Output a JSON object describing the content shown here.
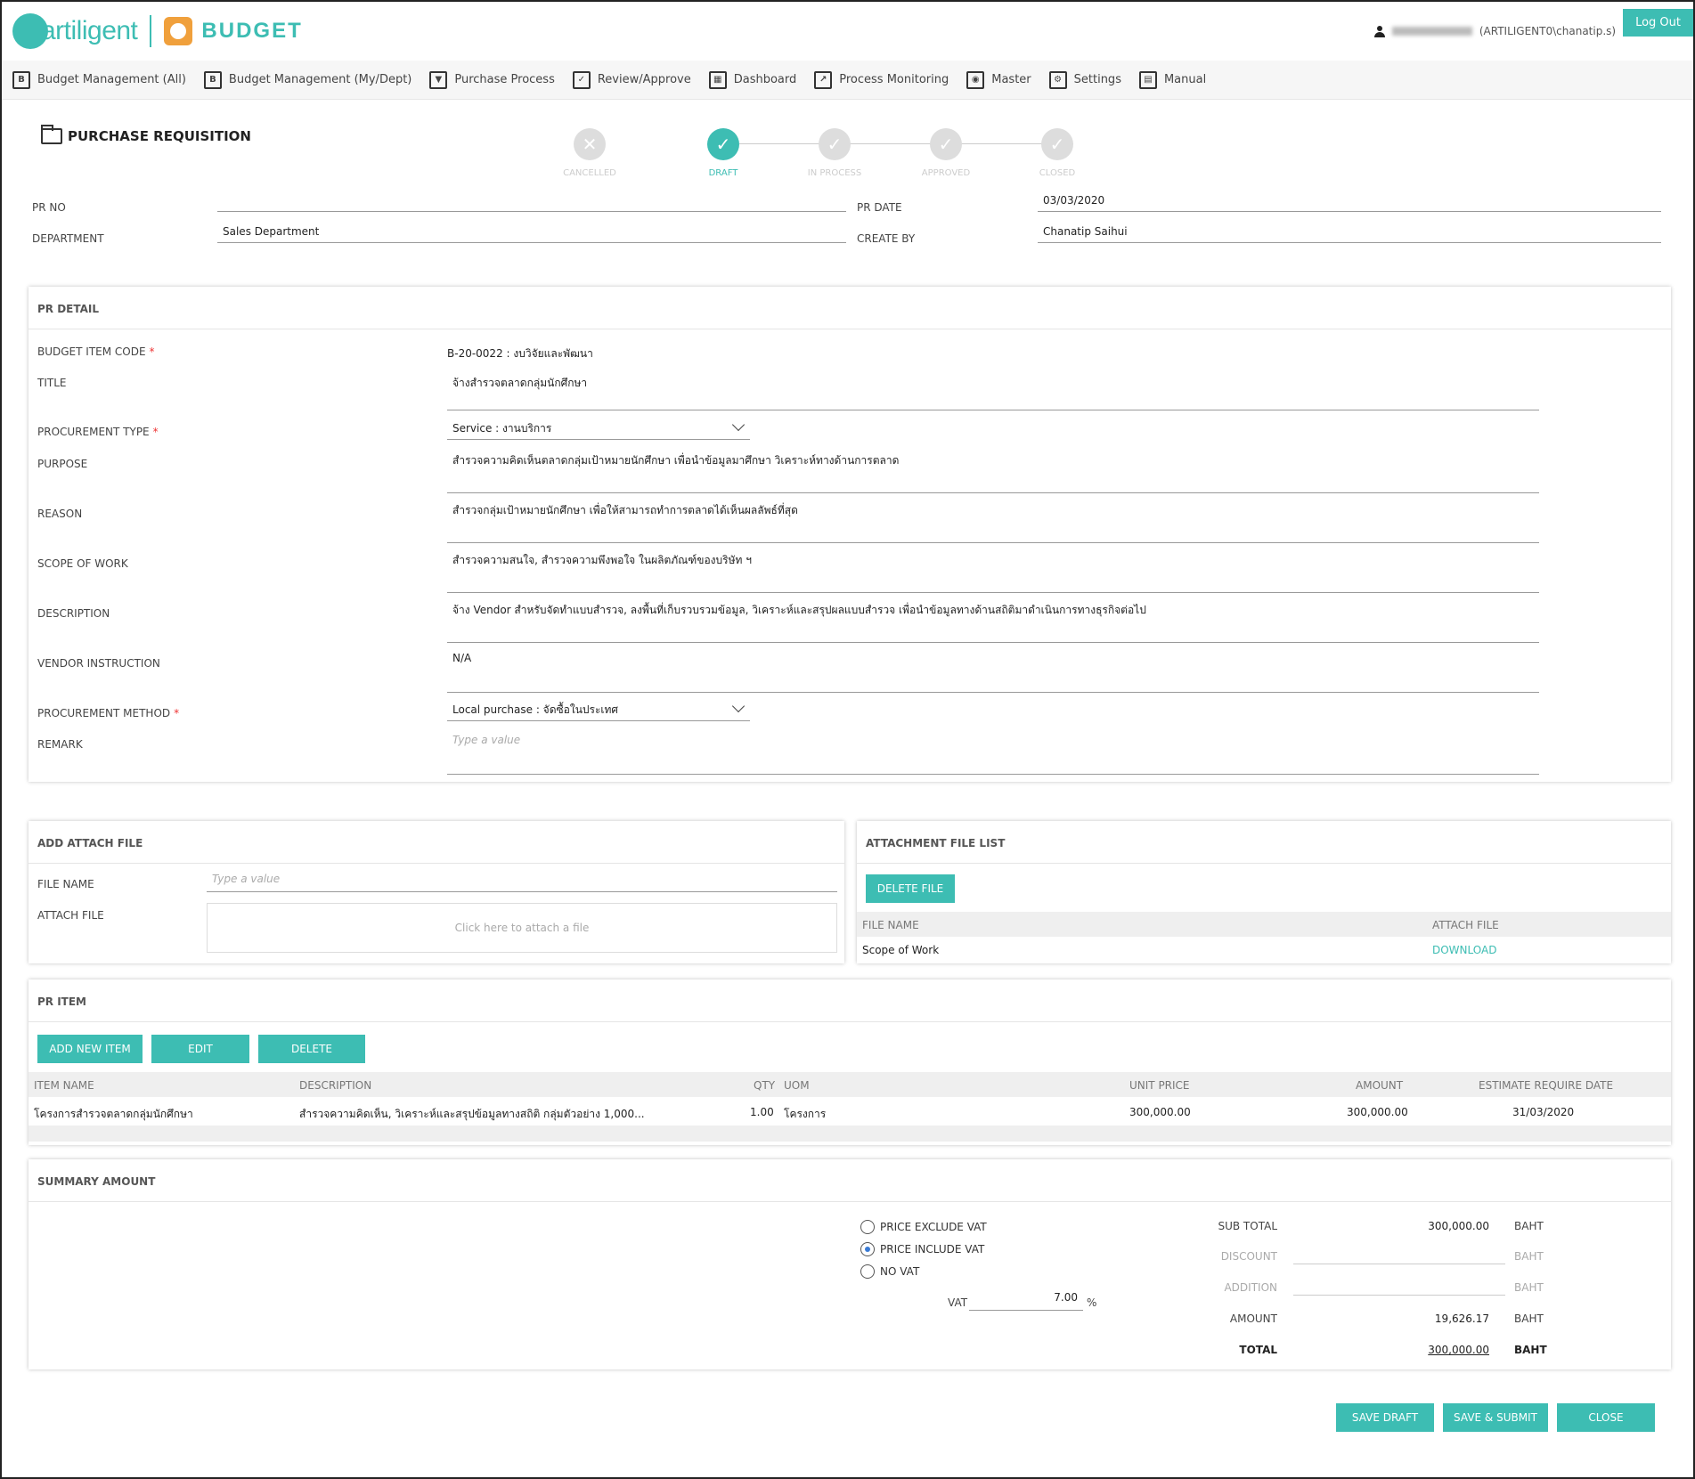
{
  "header": {
    "brand": "artiligent",
    "app_name": "BUDGET",
    "user_domain": "(ARTILIGENT0\\chanatip.s)",
    "logout_label": "Log Out"
  },
  "nav": [
    {
      "label": "Budget Management (All)",
      "icon": "B"
    },
    {
      "label": "Budget Management (My/Dept)",
      "icon": "B"
    },
    {
      "label": "Purchase Process",
      "icon": "▼"
    },
    {
      "label": "Review/Approve",
      "icon": "✓"
    },
    {
      "label": "Dashboard",
      "icon": "▦"
    },
    {
      "label": "Process Monitoring",
      "icon": "↗"
    },
    {
      "label": "Master",
      "icon": "◉"
    },
    {
      "label": "Settings",
      "icon": "⚙"
    },
    {
      "label": "Manual",
      "icon": "▤"
    }
  ],
  "page": {
    "title": "PURCHASE REQUISITION",
    "steps": [
      {
        "label": "CANCELLED",
        "state": "cancelled",
        "glyph": "✕"
      },
      {
        "label": "DRAFT",
        "state": "active",
        "glyph": "✓"
      },
      {
        "label": "IN PROCESS",
        "state": "pending",
        "glyph": "✓"
      },
      {
        "label": "APPROVED",
        "state": "pending",
        "glyph": "✓"
      },
      {
        "label": "CLOSED",
        "state": "pending",
        "glyph": "✓"
      }
    ]
  },
  "header_form": {
    "pr_no_label": "PR NO",
    "pr_no_value": "",
    "pr_date_label": "PR DATE",
    "pr_date_value": "03/03/2020",
    "department_label": "DEPARTMENT",
    "department_value": "Sales Department",
    "create_by_label": "CREATE BY",
    "create_by_value": "Chanatip Saihui"
  },
  "pr_detail": {
    "heading": "PR DETAIL",
    "budget_item_code_label": "BUDGET ITEM CODE",
    "budget_item_code_value": "B-20-0022 : งบวิจัยและพัฒนา",
    "title_label": "TITLE",
    "title_value": "จ้างสำรวจตลาดกลุ่มนักศึกษา",
    "procurement_type_label": "PROCUREMENT TYPE",
    "procurement_type_value": "Service : งานบริการ",
    "purpose_label": "PURPOSE",
    "purpose_value": "สำรวจความคิดเห็นตลาดกลุ่มเป้าหมายนักศึกษา เพื่อนำข้อมูลมาศึกษา วิเคราะห์ทางด้านการตลาด",
    "reason_label": "REASON",
    "reason_value": "สำรวจกลุ่มเป้าหมายนักศึกษา เพื่อให้สามารถทำการตลาดได้เห็นผลลัพธ์ที่สุด",
    "scope_label": "SCOPE OF WORK",
    "scope_value": "สำรวจความสนใจ, สำรวจความพึงพอใจ ในผลิตภัณฑ์ของบริษัท ฯ",
    "description_label": "DESCRIPTION",
    "description_value": "จ้าง Vendor สำหรับจัดทำแบบสำรวจ, ลงพื้นที่เก็บรวบรวมข้อมูล, วิเคราะห์และสรุปผลแบบสำรวจ เพื่อนำข้อมูลทางด้านสถิติมาดำเนินการทางธุรกิจต่อไป",
    "vendor_instruction_label": "VENDOR INSTRUCTION",
    "vendor_instruction_value": "N/A",
    "procurement_method_label": "PROCUREMENT METHOD",
    "procurement_method_value": "Local purchase : จัดซื้อในประเทศ",
    "remark_label": "REMARK",
    "remark_placeholder": "Type a value"
  },
  "attach": {
    "heading": "ADD ATTACH FILE",
    "file_name_label": "FILE NAME",
    "file_name_placeholder": "Type a value",
    "attach_file_label": "ATTACH FILE",
    "dropzone_text": "Click here to attach a file"
  },
  "attachment_list": {
    "heading": "ATTACHMENT FILE LIST",
    "delete_label": "DELETE FILE",
    "col_file_name": "FILE NAME",
    "col_attach_file": "ATTACH FILE",
    "rows": [
      {
        "file_name": "Scope of Work",
        "action": "DOWNLOAD"
      }
    ]
  },
  "pr_item": {
    "heading": "PR ITEM",
    "add_label": "ADD NEW ITEM",
    "edit_label": "EDIT",
    "delete_label": "DELETE",
    "columns": {
      "item_name": "ITEM NAME",
      "description": "DESCRIPTION",
      "qty": "QTY",
      "uom": "UOM",
      "unit_price": "UNIT PRICE",
      "amount": "AMOUNT",
      "estimate_date": "ESTIMATE REQUIRE DATE"
    },
    "rows": [
      {
        "item_name": "โครงการสำรวจตลาดกลุ่มนักศึกษา",
        "description": "สำรวจความคิดเห็น, วิเคราะห์และสรุปข้อมูลทางสถิติ กลุ่มตัวอย่าง 1,000...",
        "qty": "1.00",
        "uom": "โครงการ",
        "unit_price": "300,000.00",
        "amount": "300,000.00",
        "estimate_date": "31/03/2020"
      }
    ]
  },
  "summary": {
    "heading": "SUMMARY AMOUNT",
    "vat_options": [
      "PRICE EXCLUDE VAT",
      "PRICE INCLUDE VAT",
      "NO VAT"
    ],
    "vat_selected": "PRICE INCLUDE VAT",
    "vat_label": "VAT",
    "vat_value": "7.00",
    "vat_unit": "%",
    "sub_total_label": "SUB TOTAL",
    "sub_total_value": "300,000.00",
    "discount_label": "DISCOUNT",
    "addition_label": "ADDITION",
    "amount_label": "AMOUNT",
    "amount_value": "19,626.17",
    "total_label": "TOTAL",
    "total_value": "300,000.00",
    "currency": "BAHT"
  },
  "footer": {
    "save_draft": "SAVE DRAFT",
    "save_submit": "SAVE & SUBMIT",
    "close": "CLOSE"
  },
  "colors": {
    "accent": "#3dbdb3",
    "required": "#e33333"
  }
}
